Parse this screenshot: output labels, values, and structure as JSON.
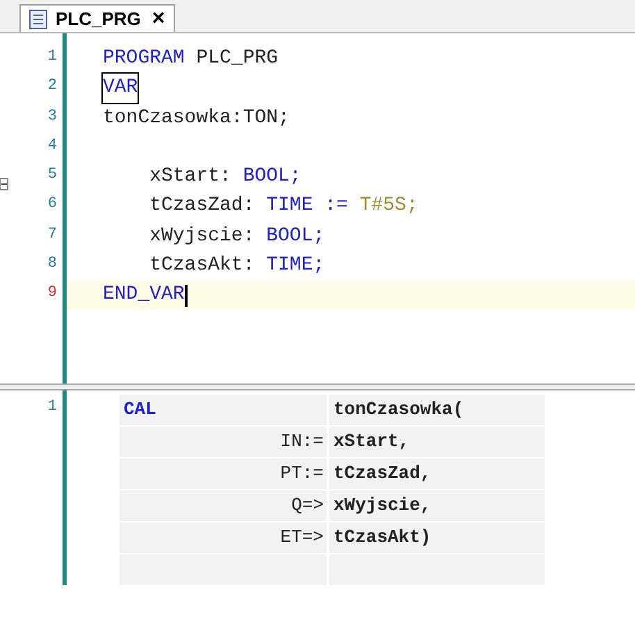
{
  "tab": {
    "label": "PLC_PRG",
    "close": "×",
    "selected": true
  },
  "declaration": {
    "lines": [
      {
        "number": "1",
        "current": false,
        "tokens": [
          {
            "kind": "keyword",
            "text": "PROGRAM"
          },
          {
            "kind": "plain",
            "text": " PLC_PRG"
          }
        ]
      },
      {
        "number": "2",
        "current": false,
        "tokens": [
          {
            "kind": "keyword",
            "text": "VAR",
            "boxed": true
          }
        ]
      },
      {
        "number": "3",
        "current": false,
        "tokens": [
          {
            "kind": "plain",
            "text": "tonCzasowka:TON;"
          }
        ]
      },
      {
        "number": "4",
        "current": false
      },
      {
        "number": "5",
        "current": false,
        "tokens": [
          {
            "kind": "plain",
            "text": "    xStart: "
          },
          {
            "kind": "keyword",
            "text": "BOOL;"
          }
        ]
      },
      {
        "number": "6",
        "current": false,
        "tokens": [
          {
            "kind": "plain",
            "text": "    tCzasZad: "
          },
          {
            "kind": "keyword",
            "text": "TIME := "
          },
          {
            "kind": "literal",
            "text": "T#5S;"
          }
        ]
      },
      {
        "number": "7",
        "current": false,
        "tokens": [
          {
            "kind": "plain",
            "text": "    xWyjscie: "
          },
          {
            "kind": "keyword",
            "text": "BOOL;"
          }
        ]
      },
      {
        "number": "8",
        "current": false,
        "tokens": [
          {
            "kind": "plain",
            "text": "    tCzasAkt: "
          },
          {
            "kind": "keyword",
            "text": "TIME;"
          }
        ]
      },
      {
        "number": "9",
        "current": true,
        "tokens": [
          {
            "kind": "keyword",
            "text": "END_VAR"
          }
        ]
      }
    ]
  },
  "implementation": {
    "line_number": "1",
    "rows": [
      {
        "operator": "CAL",
        "operand": "tonCzasowka("
      },
      {
        "operator": "IN:=",
        "operand": "xStart,"
      },
      {
        "operator": "PT:=",
        "operand": "tCzasZad,"
      },
      {
        "operator": "Q=>",
        "operand": "xWyjscie,"
      },
      {
        "operator": "ET=>",
        "operand": "tCzasAkt)"
      },
      {
        "operator": "",
        "operand": ""
      }
    ]
  }
}
